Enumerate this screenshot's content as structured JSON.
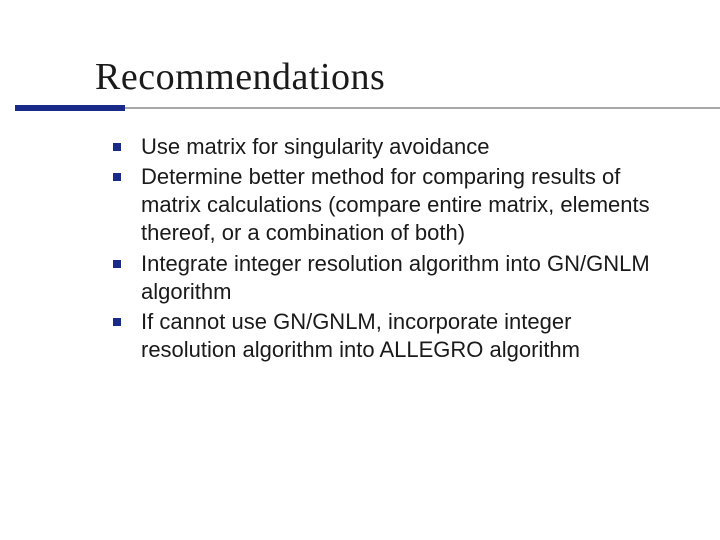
{
  "title": "Recommendations",
  "bullets": [
    "Use matrix for singularity avoidance",
    "Determine better method for comparing results of matrix calculations (compare entire matrix, elements thereof, or a combination of both)",
    "Integrate integer resolution algorithm into GN/GNLM algorithm",
    "If cannot use GN/GNLM, incorporate integer resolution algorithm into ALLEGRO algorithm"
  ]
}
